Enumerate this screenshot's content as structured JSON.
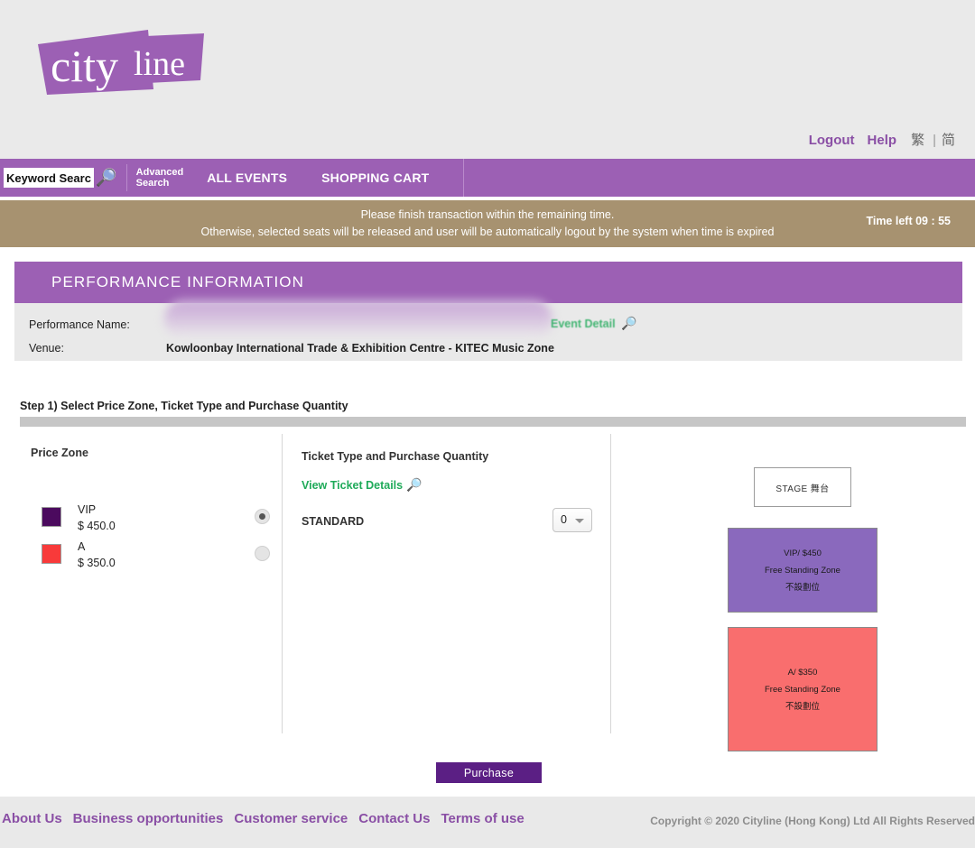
{
  "header": {
    "logo_city": "city",
    "logo_line": "line",
    "util_nav": [
      {
        "label": "Logout",
        "type": "link"
      },
      {
        "label": "Help",
        "type": "link"
      }
    ],
    "lang_trad": "繁",
    "lang_sep": "|",
    "lang_simp": "简"
  },
  "nav": {
    "search_value": "Keyword Search",
    "search_placeholder": "Keyword Search",
    "search_icon": "search-icon",
    "advanced_search_line1": "Advanced",
    "advanced_search_line2": "Search",
    "all_events": "ALL EVENTS",
    "shopping_cart": "SHOPPING CART"
  },
  "timer": {
    "message_line1": "Please finish transaction within the remaining time.",
    "message_line2": "Otherwise, selected seats will be released and user will be automatically logout by the system when time is expired",
    "time_left": "Time left 09 : 55",
    "bar_color": "#a79270"
  },
  "performance": {
    "panel_title": "PERFORMANCE  INFORMATION",
    "name_label": "Performance Name:",
    "name_value": "",
    "venue_label": "Venue:",
    "venue_value": "Kowloonbay International Trade & Exhibition Centre - KITEC Music Zone",
    "event_detail_label": "Event Detail",
    "event_detail_icon": "magnifier-icon"
  },
  "step": {
    "title": "Step 1) Select Price Zone, Ticket Type and Purchase Quantity"
  },
  "price_zone": {
    "heading": "Price Zone",
    "zones": [
      {
        "name": "VIP",
        "price": "$ 450.0",
        "color": "#4b0a5e",
        "selected": true
      },
      {
        "name": "A",
        "price": "$ 350.0",
        "color": "#f83a3a",
        "selected": false
      }
    ]
  },
  "ticket": {
    "heading": "Ticket Type and Purchase Quantity",
    "view_details_label": "View Ticket Details",
    "view_details_icon": "magnifier-icon",
    "rows": [
      {
        "type": "STANDARD",
        "quantity": "0"
      }
    ]
  },
  "seatmap": {
    "stage_label": "STAGE 舞台",
    "zones": [
      {
        "id": "vip",
        "line1": "VIP/ $450",
        "line2": "Free Standing Zone",
        "line3": "不設劃位",
        "color": "#8a69bd"
      },
      {
        "id": "a",
        "line1": "A/ $350",
        "line2": "Free Standing Zone",
        "line3": "不設劃位",
        "color": "#f96e6e"
      }
    ]
  },
  "actions": {
    "purchase_label": "Purchase"
  },
  "footer": {
    "links": [
      "About Us",
      "Business opportunities",
      "Customer service",
      "Contact Us",
      "Terms of use"
    ],
    "copyright": "Copyright © 2020 Cityline (Hong Kong) Ltd All Rights Reserved"
  }
}
